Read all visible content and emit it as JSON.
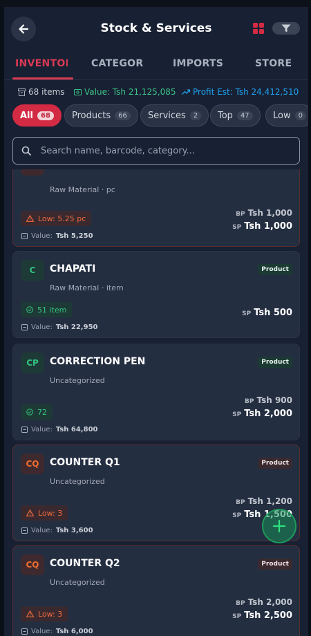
{
  "header": {
    "title": "Stock & Services"
  },
  "tabs": [
    "INVENTORY",
    "CATEGORIES",
    "IMPORTS",
    "STORE"
  ],
  "stats": {
    "items": "68 items",
    "value": "Value: Tsh 21,125,085",
    "profit": "Profit Est: Tsh 24,412,510"
  },
  "chips": [
    {
      "label": "All",
      "count": "68"
    },
    {
      "label": "Products",
      "count": "66"
    },
    {
      "label": "Services",
      "count": "2"
    },
    {
      "label": "Top",
      "count": "47"
    },
    {
      "label": "Low",
      "count": "0"
    }
  ],
  "search": {
    "placeholder": "Search name, barcode, category..."
  },
  "items": [
    {
      "category": "Raw Material · pc",
      "stock": "Low: 5.25 pc",
      "value_label": "Value:",
      "value": "Tsh 5,250",
      "bp_label": "BP",
      "bp": "Tsh 1,000",
      "sp_label": "SP",
      "sp": "Tsh 1,000"
    },
    {
      "initials": "C",
      "name": "CHAPATI",
      "type": "Product",
      "category": "Raw Material · item",
      "stock": "51 item",
      "value_label": "Value:",
      "value": "Tsh 22,950",
      "sp_label": "SP",
      "sp": "Tsh 500"
    },
    {
      "initials": "CP",
      "name": "CORRECTION PEN",
      "type": "Product",
      "category": "Uncategorized",
      "stock": "72",
      "value_label": "Value:",
      "value": "Tsh 64,800",
      "bp_label": "BP",
      "bp": "Tsh 900",
      "sp_label": "SP",
      "sp": "Tsh 2,000"
    },
    {
      "initials": "CQ",
      "name": "COUNTER Q1",
      "type": "Product",
      "category": "Uncategorized",
      "stock": "Low: 3",
      "value_label": "Value:",
      "value": "Tsh 3,600",
      "bp_label": "BP",
      "bp": "Tsh 1,200",
      "sp_label": "SP",
      "sp": "Tsh 1,500"
    },
    {
      "initials": "CQ",
      "name": "COUNTER Q2",
      "type": "Product",
      "category": "Uncategorized",
      "stock": "Low: 3",
      "value_label": "Value:",
      "value": "Tsh 6,000",
      "bp_label": "BP",
      "bp": "Tsh 2,000",
      "sp_label": "SP",
      "sp": "Tsh 2,500"
    }
  ],
  "colors": {
    "accent": "#d42b44",
    "success": "#32c27f",
    "warning": "#ee6c2f",
    "info": "#1ea3f0"
  }
}
